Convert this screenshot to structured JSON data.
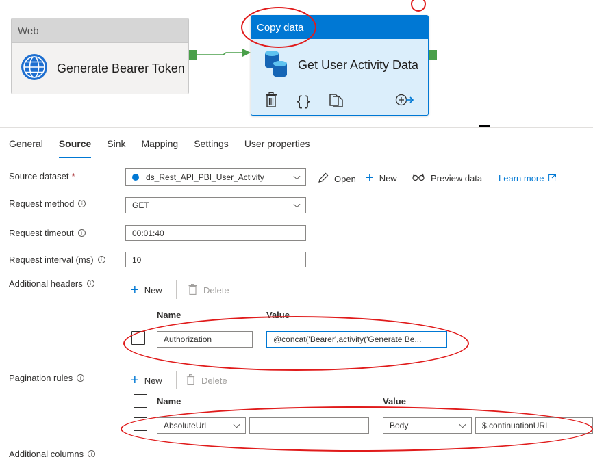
{
  "pipeline": {
    "web_activity": {
      "type_label": "Web",
      "title": "Generate Bearer Token",
      "icon": "globe-icon"
    },
    "copy_activity": {
      "type_label": "Copy data",
      "title": "Get User Activity Data",
      "icon": "database-icon",
      "actions": [
        "delete-icon",
        "code-icon",
        "copy-icon",
        "add-output-icon"
      ]
    }
  },
  "tabs": [
    {
      "label": "General"
    },
    {
      "label": "Source",
      "active": true
    },
    {
      "label": "Sink"
    },
    {
      "label": "Mapping"
    },
    {
      "label": "Settings"
    },
    {
      "label": "User properties"
    }
  ],
  "source": {
    "dataset_label": "Source dataset",
    "required_mark": "*",
    "dataset_value": "ds_Rest_API_PBI_User_Activity",
    "open_label": "Open",
    "new_label": "New",
    "preview_label": "Preview data",
    "learn_more_label": "Learn more",
    "request_method_label": "Request method",
    "request_method_value": "GET",
    "request_timeout_label": "Request timeout",
    "request_timeout_value": "00:01:40",
    "request_interval_label": "Request interval (ms)",
    "request_interval_value": "10",
    "additional_headers_label": "Additional headers",
    "headers_new_label": "New",
    "headers_delete_label": "Delete",
    "headers_col_name": "Name",
    "headers_col_value": "Value",
    "headers_rows": [
      {
        "name": "Authorization",
        "value": "@concat('Bearer',activity('Generate Be..."
      }
    ],
    "pagination_label": "Pagination rules",
    "pagination_new_label": "New",
    "pagination_delete_label": "Delete",
    "pagination_col_name": "Name",
    "pagination_col_value": "Value",
    "pagination_rows": [
      {
        "name": "AbsoluteUrl",
        "name_extra": "",
        "value_type": "Body",
        "value": "$.continuationURI"
      }
    ],
    "additional_columns_label": "Additional columns"
  },
  "colors": {
    "accent": "#0078d4",
    "annotation": "#e01b1b",
    "port": "#4a9f4a"
  }
}
